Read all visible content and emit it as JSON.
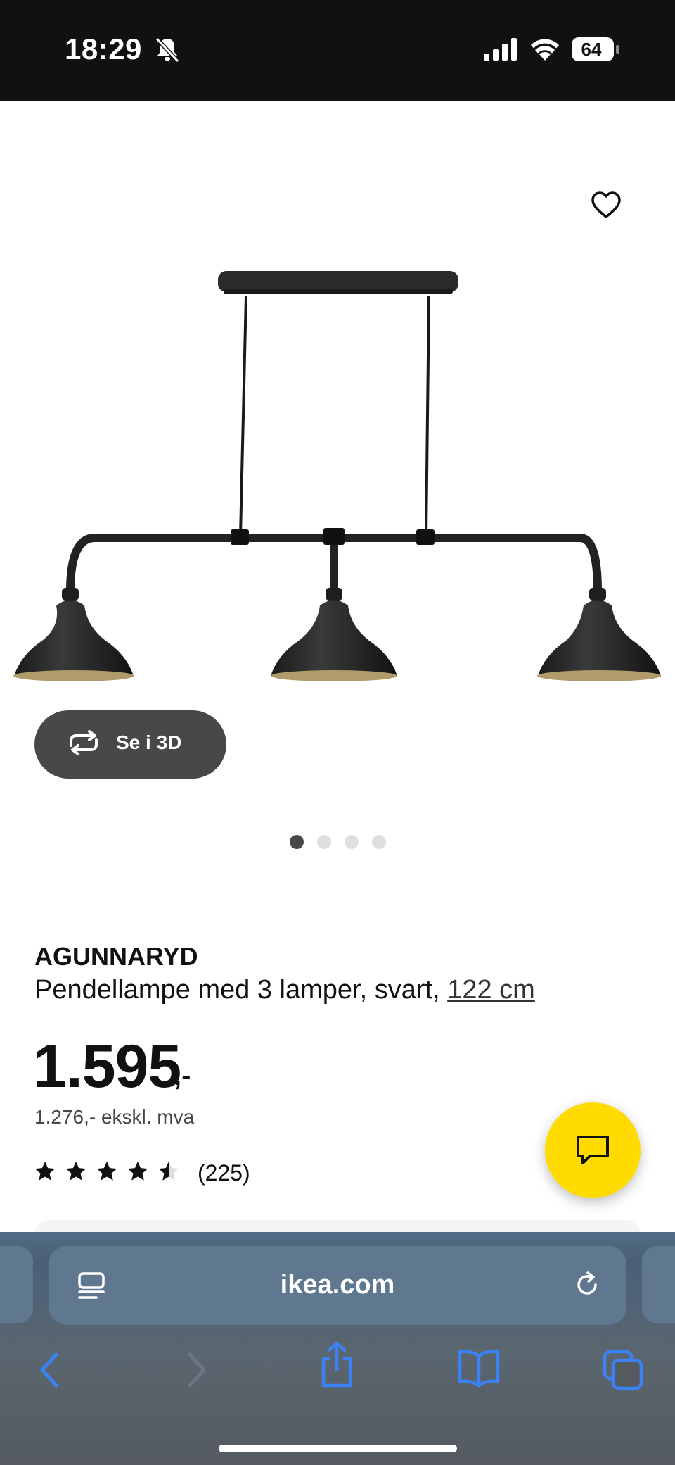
{
  "status_bar": {
    "time": "18:29",
    "battery_level": "64",
    "icons": [
      "bell-slash-icon",
      "signal-icon",
      "wifi-icon",
      "battery-icon"
    ]
  },
  "product": {
    "brand": "AGUNNARYD",
    "description": "Pendellampe med 3 lamper, svart, ",
    "size": "122 cm",
    "price": "1.595",
    "price_suffix": ",-",
    "price_ex_vat": "1.276,- ekskl. mva",
    "rating": 4.5,
    "rating_count": "(225)",
    "view_3d_label": "Se i 3D",
    "image_count": 4,
    "active_image": 1
  },
  "colors": {
    "accent_yellow": "#FFDB00",
    "button_dark": "#484848",
    "browser_blue": "#3b82f6"
  },
  "browser": {
    "url": "ikea.com",
    "nav": [
      "back-icon",
      "forward-icon",
      "share-icon",
      "bookmarks-icon",
      "tabs-icon"
    ]
  }
}
